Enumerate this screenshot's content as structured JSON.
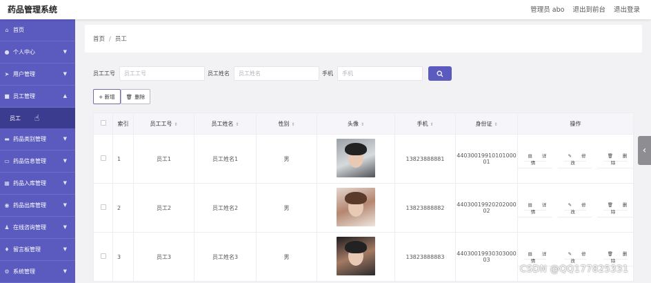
{
  "header": {
    "brand": "药品管理系统",
    "user_label": "管理员 abo",
    "front_link": "退出到前台",
    "logout_link": "退出登录"
  },
  "sidebar": {
    "items": [
      {
        "label": "首页",
        "icon": "home-icon",
        "chevron": false
      },
      {
        "label": "个人中心",
        "icon": "user-icon",
        "chevron": true
      },
      {
        "label": "用户管理",
        "icon": "send-icon",
        "chevron": true
      },
      {
        "label": "员工管理",
        "icon": "folder-icon",
        "chevron": true,
        "expanded": true
      },
      {
        "label": "员工",
        "sub": true
      },
      {
        "label": "药品类别管理",
        "icon": "card-icon",
        "chevron": true
      },
      {
        "label": "药品信息管理",
        "icon": "monitor-icon",
        "chevron": true
      },
      {
        "label": "药品入库管理",
        "icon": "calendar-icon",
        "chevron": true
      },
      {
        "label": "药品出库管理",
        "icon": "globe-icon",
        "chevron": true
      },
      {
        "label": "在线咨询管理",
        "icon": "person-icon",
        "chevron": true
      },
      {
        "label": "留言板管理",
        "icon": "bulb-icon",
        "chevron": true
      },
      {
        "label": "系统管理",
        "icon": "gear-icon",
        "chevron": true
      }
    ]
  },
  "breadcrumb": {
    "home": "首页",
    "separator": "/",
    "current": "员工"
  },
  "search": {
    "emp_no_label": "员工工号",
    "emp_no_placeholder": "员工工号",
    "emp_name_label": "员工姓名",
    "emp_name_placeholder": "员工姓名",
    "phone_label": "手机",
    "phone_placeholder": "手机",
    "search_icon": "search-icon"
  },
  "actions": {
    "add": "+ 新增",
    "delete": "删除"
  },
  "table": {
    "headers": {
      "index": "索引",
      "emp_no": "员工工号",
      "emp_name": "员工姓名",
      "gender": "性别",
      "avatar": "头像",
      "phone": "手机",
      "id_card": "身份证",
      "ops": "操作"
    },
    "rows": [
      {
        "index": "1",
        "emp_no": "员工1",
        "emp_name": "员工姓名1",
        "gender": "男",
        "phone": "13823888881",
        "id_line1": "44030019910101000",
        "id_line2": "01"
      },
      {
        "index": "2",
        "emp_no": "员工2",
        "emp_name": "员工姓名2",
        "gender": "男",
        "phone": "13823888882",
        "id_line1": "44030019920202000",
        "id_line2": "02"
      },
      {
        "index": "3",
        "emp_no": "员工3",
        "emp_name": "员工姓名3",
        "gender": "男",
        "phone": "13823888883",
        "id_line1": "44030019930303000",
        "id_line2": "03"
      }
    ],
    "op_labels": {
      "detail": "详情",
      "edit": "修改",
      "delete": "删除"
    }
  },
  "watermark": "CSDN @QQ177825331",
  "colors": {
    "accent": "#5b5bbf",
    "sidebar_active": "#3b3b8f"
  }
}
